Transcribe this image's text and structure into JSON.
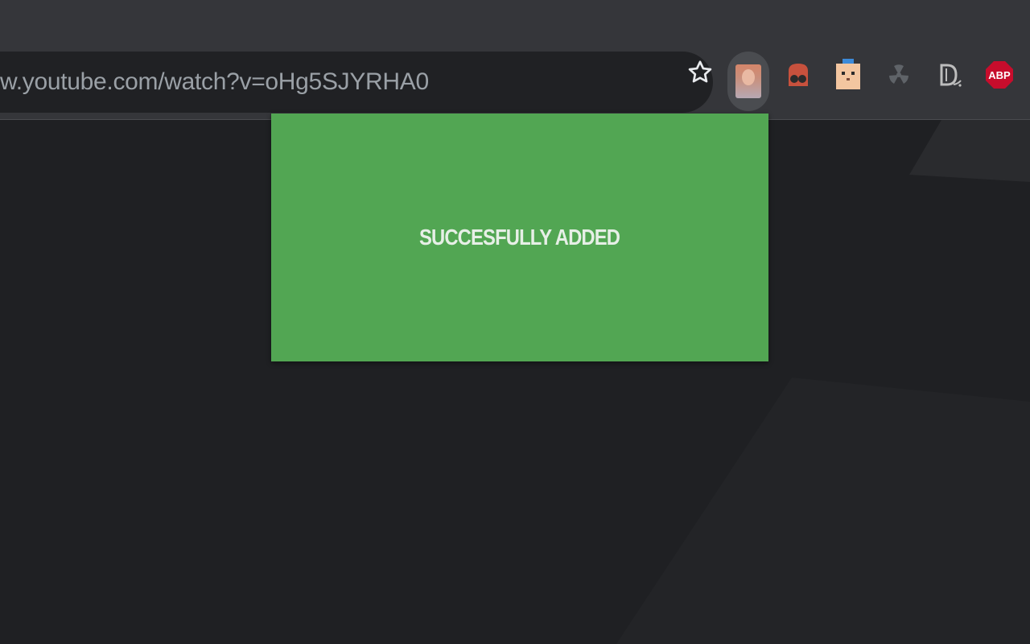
{
  "browser": {
    "address_bar": {
      "url_text": "w.youtube.com/watch?v=oHg5SJYRHA0"
    },
    "bookmark": {
      "icon": "star-outline-icon"
    },
    "extensions": [
      {
        "name": "profile-avatar",
        "icon": "profile-photo-icon",
        "active": true
      },
      {
        "name": "ghostery",
        "icon": "ghost-icon",
        "color": "#c7513d"
      },
      {
        "name": "cat-extension",
        "icon": "cat-face-icon",
        "color": "#f3c6a0"
      },
      {
        "name": "radiation-extension",
        "icon": "radiation-icon",
        "color": "#5f6368"
      },
      {
        "name": "dl-extension",
        "icon": "d-logo-icon",
        "color": "#bdbdbd"
      },
      {
        "name": "adblock-plus",
        "label": "ABP",
        "icon": "abp-stop-sign-icon",
        "color": "#c70d2c"
      }
    ]
  },
  "popup": {
    "message": "SUCCESFULLY ADDED",
    "background": "#52a653"
  },
  "colors": {
    "toolbar": "#35363a",
    "page_background": "#1f2023"
  }
}
